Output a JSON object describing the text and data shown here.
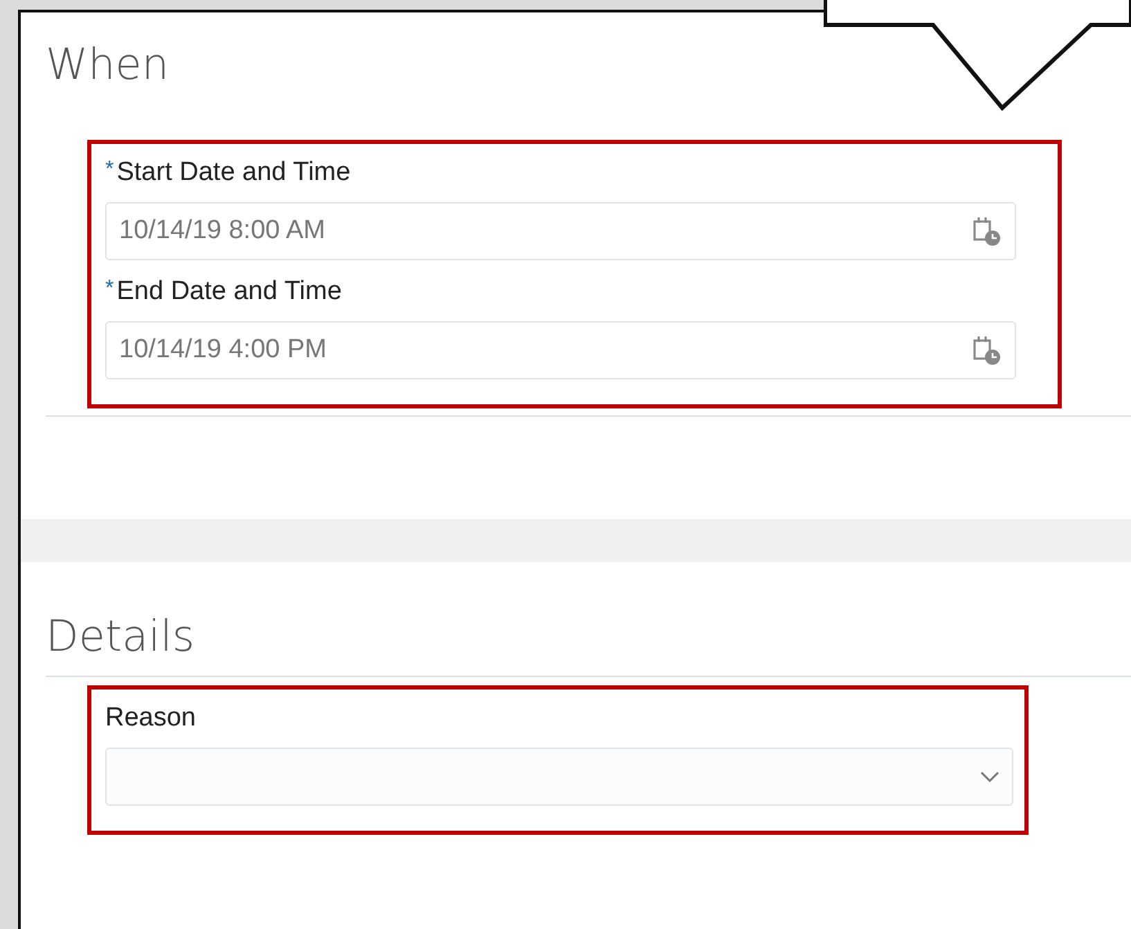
{
  "sections": [
    {
      "title": "When",
      "highlighted": true,
      "fields": [
        {
          "kind": "datetime",
          "label": "Start Date and Time",
          "required_mark": "*",
          "value": "10/14/19 8:00 AM"
        },
        {
          "kind": "datetime",
          "label": "End Date and Time",
          "required_mark": "*",
          "value": "10/14/19 4:00 PM"
        }
      ]
    },
    {
      "title": "Details",
      "highlighted": true,
      "fields": [
        {
          "kind": "select",
          "label": "Reason"
        }
      ]
    }
  ]
}
